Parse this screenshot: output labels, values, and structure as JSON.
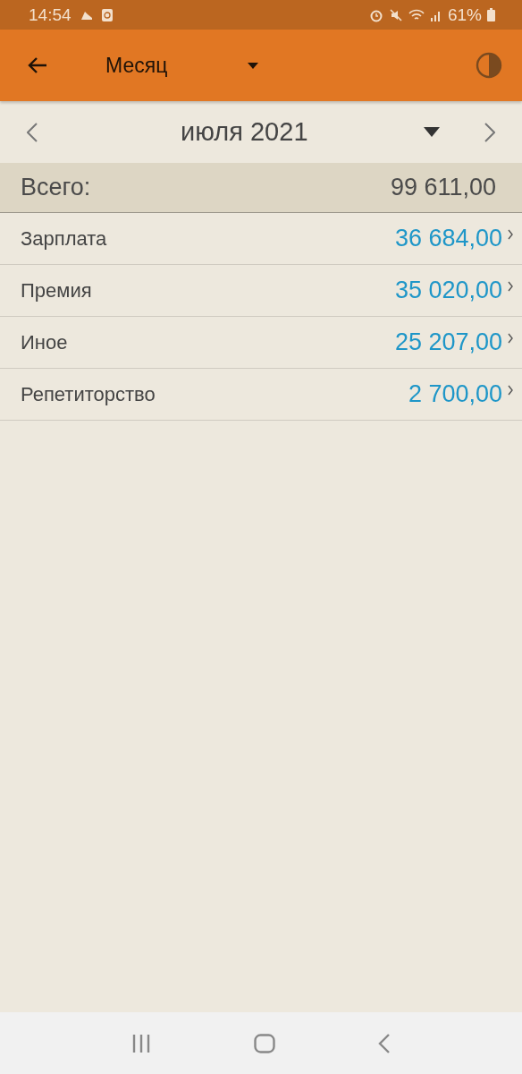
{
  "status_bar": {
    "time": "14:54",
    "battery": "61%"
  },
  "app_bar": {
    "title": "Месяц"
  },
  "period": {
    "label": "июля 2021"
  },
  "total": {
    "label": "Всего:",
    "amount": "99 611,00"
  },
  "rows": [
    {
      "name": "Зарплата",
      "amount": "36 684,00"
    },
    {
      "name": "Премия",
      "amount": "35 020,00"
    },
    {
      "name": "Иное",
      "amount": "25 207,00"
    },
    {
      "name": "Репетиторство",
      "amount": "2 700,00"
    }
  ]
}
